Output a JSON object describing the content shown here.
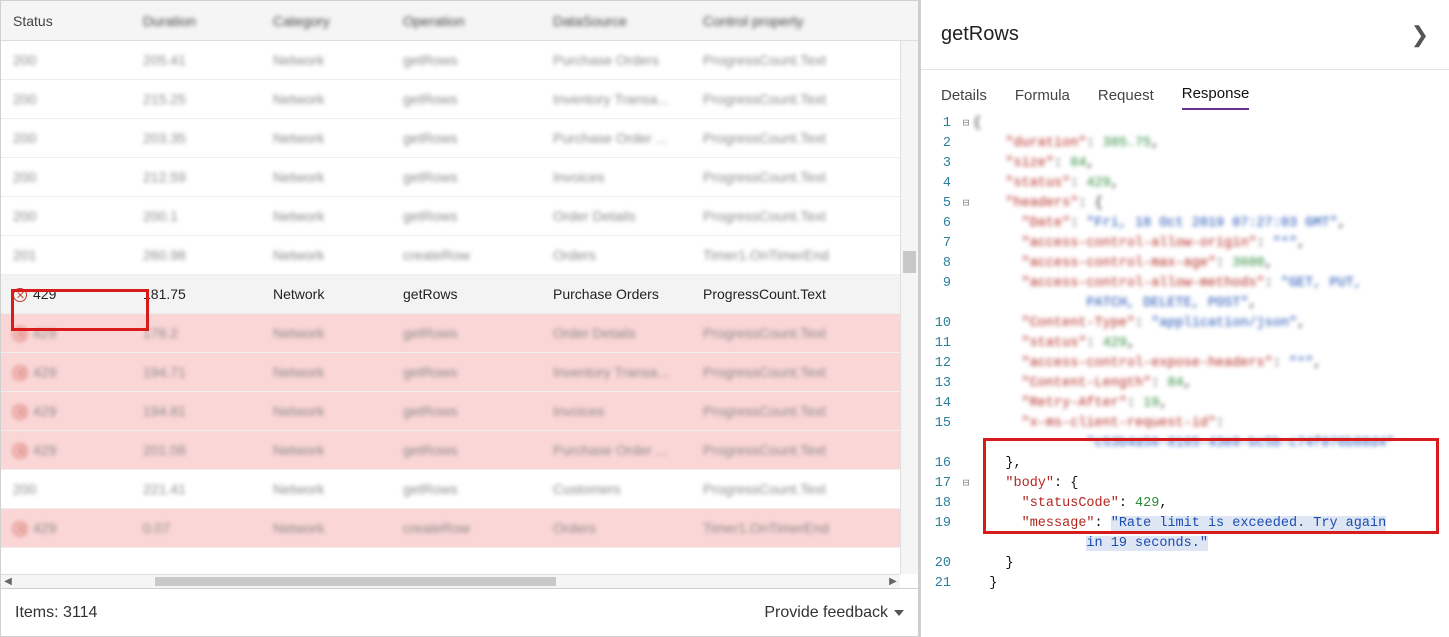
{
  "columns": {
    "status": "Status",
    "duration": "Duration",
    "category": "Category",
    "operation": "Operation",
    "datasource": "DataSource",
    "control": "Control property"
  },
  "rows": [
    {
      "status": "200",
      "duration": "205.41",
      "category": "Network",
      "operation": "getRows",
      "datasource": "Purchase Orders",
      "control": "ProgressCount.Text",
      "err": false
    },
    {
      "status": "200",
      "duration": "215.25",
      "category": "Network",
      "operation": "getRows",
      "datasource": "Inventory Transa...",
      "control": "ProgressCount.Text",
      "err": false
    },
    {
      "status": "200",
      "duration": "203.35",
      "category": "Network",
      "operation": "getRows",
      "datasource": "Purchase Order ...",
      "control": "ProgressCount.Text",
      "err": false
    },
    {
      "status": "200",
      "duration": "212.59",
      "category": "Network",
      "operation": "getRows",
      "datasource": "Invoices",
      "control": "ProgressCount.Text",
      "err": false
    },
    {
      "status": "200",
      "duration": "200.1",
      "category": "Network",
      "operation": "getRows",
      "datasource": "Order Details",
      "control": "ProgressCount.Text",
      "err": false
    },
    {
      "status": "201",
      "duration": "260.98",
      "category": "Network",
      "operation": "createRow",
      "datasource": "Orders",
      "control": "Timer1.OnTimerEnd",
      "err": false
    },
    {
      "status": "429",
      "duration": "181.75",
      "category": "Network",
      "operation": "getRows",
      "datasource": "Purchase Orders",
      "control": "ProgressCount.Text",
      "err": true,
      "selected": true
    },
    {
      "status": "429",
      "duration": "178.2",
      "category": "Network",
      "operation": "getRows",
      "datasource": "Order Details",
      "control": "ProgressCount.Text",
      "err": true
    },
    {
      "status": "429",
      "duration": "194.71",
      "category": "Network",
      "operation": "getRows",
      "datasource": "Inventory Transa...",
      "control": "ProgressCount.Text",
      "err": true
    },
    {
      "status": "429",
      "duration": "194.81",
      "category": "Network",
      "operation": "getRows",
      "datasource": "Invoices",
      "control": "ProgressCount.Text",
      "err": true
    },
    {
      "status": "429",
      "duration": "201.08",
      "category": "Network",
      "operation": "getRows",
      "datasource": "Purchase Order ...",
      "control": "ProgressCount.Text",
      "err": true
    },
    {
      "status": "200",
      "duration": "221.41",
      "category": "Network",
      "operation": "getRows",
      "datasource": "Customers",
      "control": "ProgressCount.Text",
      "err": false
    },
    {
      "status": "429",
      "duration": "0.07",
      "category": "Network",
      "operation": "createRow",
      "datasource": "Orders",
      "control": "Timer1.OnTimerEnd",
      "err": true
    }
  ],
  "footer": {
    "items": "Items: 3114",
    "feedback": "Provide feedback"
  },
  "detail": {
    "title": "getRows",
    "tabs": {
      "details": "Details",
      "formula": "Formula",
      "request": "Request",
      "response": "Response"
    },
    "response": {
      "duration_key": "\"duration\"",
      "duration_val": "385.75",
      "size_key": "\"size\"",
      "size_val": "84",
      "status_key": "\"status\"",
      "status_val": "429",
      "headers_key": "\"headers\"",
      "date_key": "\"Date\"",
      "date_val": "\"Fri, 18 Oct 2019 07:27:03 GMT\"",
      "acao_key": "\"access-control-allow-origin\"",
      "acao_val": "\"*\"",
      "acma_key": "\"access-control-max-age\"",
      "acma_val": "3600",
      "acam_key": "\"access-control-allow-methods\"",
      "acam_val": "\"GET, PUT,",
      "acam_val2": "PATCH, DELETE, POST\"",
      "ctype_key": "\"Content-Type\"",
      "ctype_val": "\"application/json\"",
      "status2_key": "\"status\"",
      "status2_val": "429",
      "aceh_key": "\"access-control-expose-headers\"",
      "aceh_val": "\"*\"",
      "clen_key": "\"Content-Length\"",
      "clen_val": "84",
      "retry_key": "\"Retry-After\"",
      "retry_val": "19",
      "reqid_key": "\"x-ms-client-request-id\"",
      "reqid_val": "\"c53b4a56-8165-43e0-bc5b-c74f076b88d4\"",
      "body_key": "\"body\"",
      "statusCode_key": "\"statusCode\"",
      "statusCode_val": "429",
      "message_key": "\"message\"",
      "message_val": "\"Rate limit is exceeded. Try again",
      "message_val2": "in 19 seconds.\""
    }
  }
}
